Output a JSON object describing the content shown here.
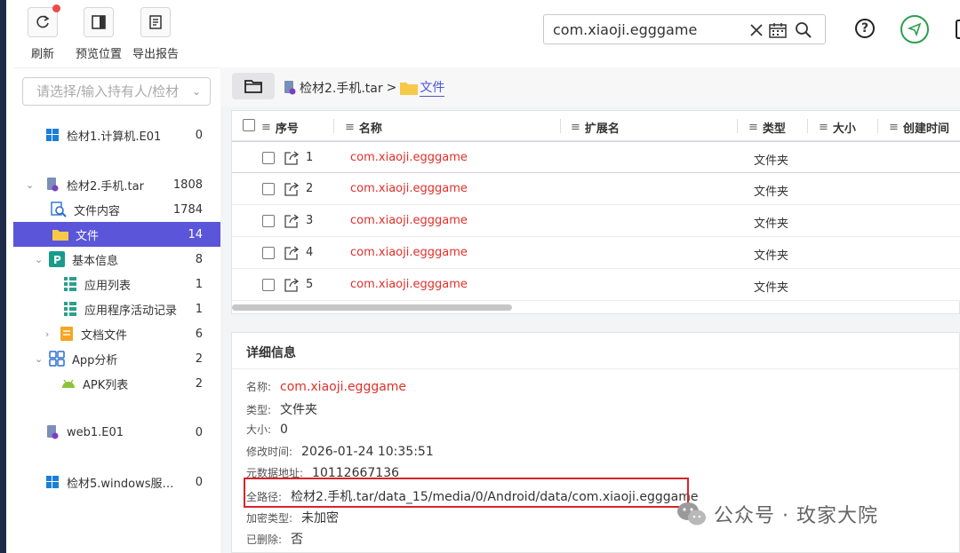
{
  "toolbar": {
    "refresh_label": "刷新",
    "preview_label": "预览位置",
    "export_label": "导出报告",
    "search_value": "com.xiaoji.egggame",
    "help_label": "?"
  },
  "sidebar": {
    "owner_placeholder": "请选择/输入持有人/检材",
    "items": [
      {
        "label": "检材1.计算机.E01",
        "count": "0"
      },
      {
        "label": "检材2.手机.tar",
        "count": "1808"
      },
      {
        "label": "文件内容",
        "count": "1784"
      },
      {
        "label": "文件",
        "count": "14"
      },
      {
        "label": "基本信息",
        "count": "8"
      },
      {
        "label": "应用列表",
        "count": "1"
      },
      {
        "label": "应用程序活动记录",
        "count": "1"
      },
      {
        "label": "文档文件",
        "count": "6"
      },
      {
        "label": "App分析",
        "count": "2"
      },
      {
        "label": "APK列表",
        "count": "2"
      },
      {
        "label": "web1.E01",
        "count": "0"
      },
      {
        "label": "检材5.windows服务...",
        "count": "0"
      }
    ]
  },
  "breadcrumb": {
    "root": "检材2.手机.tar",
    "sep": ">",
    "current": "文件"
  },
  "table": {
    "columns": [
      "序号",
      "名称",
      "扩展名",
      "类型",
      "大小",
      "创建时间"
    ],
    "rows": [
      {
        "no": "1",
        "name": "com.xiaoji.egggame",
        "type": "文件夹"
      },
      {
        "no": "2",
        "name": "com.xiaoji.egggame",
        "type": "文件夹"
      },
      {
        "no": "3",
        "name": "com.xiaoji.egggame",
        "type": "文件夹"
      },
      {
        "no": "4",
        "name": "com.xiaoji.egggame",
        "type": "文件夹"
      },
      {
        "no": "5",
        "name": "com.xiaoji.egggame",
        "type": "文件夹"
      }
    ]
  },
  "detail": {
    "title": "详细信息",
    "fields": [
      {
        "label": "名称:",
        "value": "com.xiaoji.egggame"
      },
      {
        "label": "类型:",
        "value": "文件夹"
      },
      {
        "label": "大小:",
        "value": "0"
      },
      {
        "label": "修改时间:",
        "value": "2026-01-24 10:35:51"
      },
      {
        "label": "元数据地址:",
        "value": "10112667136"
      },
      {
        "label": "全路径:",
        "value": "检材2.手机.tar/data_15/media/0/Android/data/com.xiaoji.egggame"
      },
      {
        "label": "加密类型:",
        "value": "未加密"
      },
      {
        "label": "已删除:",
        "value": "否"
      }
    ]
  },
  "watermark": {
    "text": "公众号 · 玫家大院"
  },
  "colors": {
    "accent": "#5b55d9",
    "link": "#4a55d8",
    "name_red": "#e0302a",
    "highlight_box": "#d9232a"
  }
}
